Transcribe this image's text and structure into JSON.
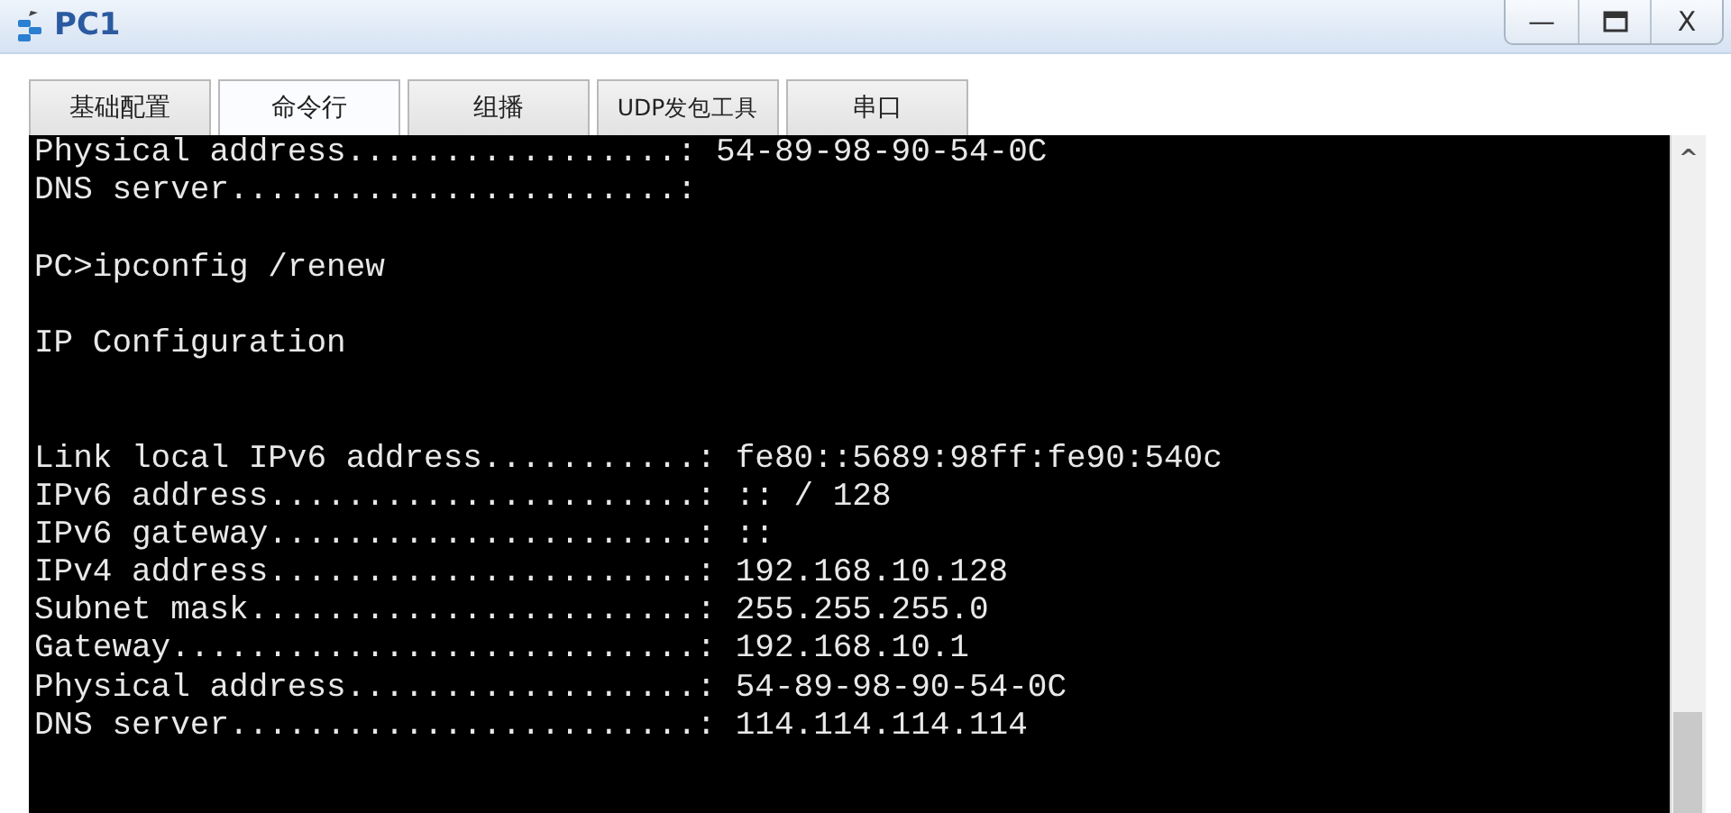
{
  "window": {
    "title": "PC1",
    "controls": [
      {
        "kind": "minimize",
        "label": "—"
      },
      {
        "kind": "maximize"
      },
      {
        "kind": "close",
        "label": "X"
      }
    ]
  },
  "tabs": [
    {
      "label": "基础配置",
      "selected": false
    },
    {
      "label": "命令行",
      "selected": true
    },
    {
      "label": "组播",
      "selected": false
    },
    {
      "label": "UDP发包工具",
      "selected": false
    },
    {
      "label": "串口",
      "selected": false
    }
  ],
  "terminal": {
    "lines": [
      {
        "text": "Physical address.................: 54-89-98-90-54-0C"
      },
      {
        "text": "DNS server.......................:"
      },
      {
        "kind": "blank"
      },
      {
        "text": "PC>ipconfig /renew"
      },
      {
        "kind": "blank"
      },
      {
        "text": "IP Configuration"
      },
      {
        "kind": "blank"
      },
      {
        "kind": "blank"
      },
      {
        "text": "Link local IPv6 address...........: fe80::5689:98ff:fe90:540c"
      },
      {
        "text": "IPv6 address......................: :: / 128"
      },
      {
        "text": "IPv6 gateway......................: ::"
      },
      {
        "text": "IPv4 address......................: 192.168.10.128"
      },
      {
        "text": "Subnet mask.......................: 255.255.255.0"
      },
      {
        "text": "Gateway...........................: 192.168.10.1"
      },
      {
        "text": "Physical address..................: 54-89-98-90-54-0C"
      },
      {
        "text": "DNS server........................: 114.114.114.114"
      }
    ],
    "scrollbar": {
      "up_arrow": "^"
    }
  }
}
